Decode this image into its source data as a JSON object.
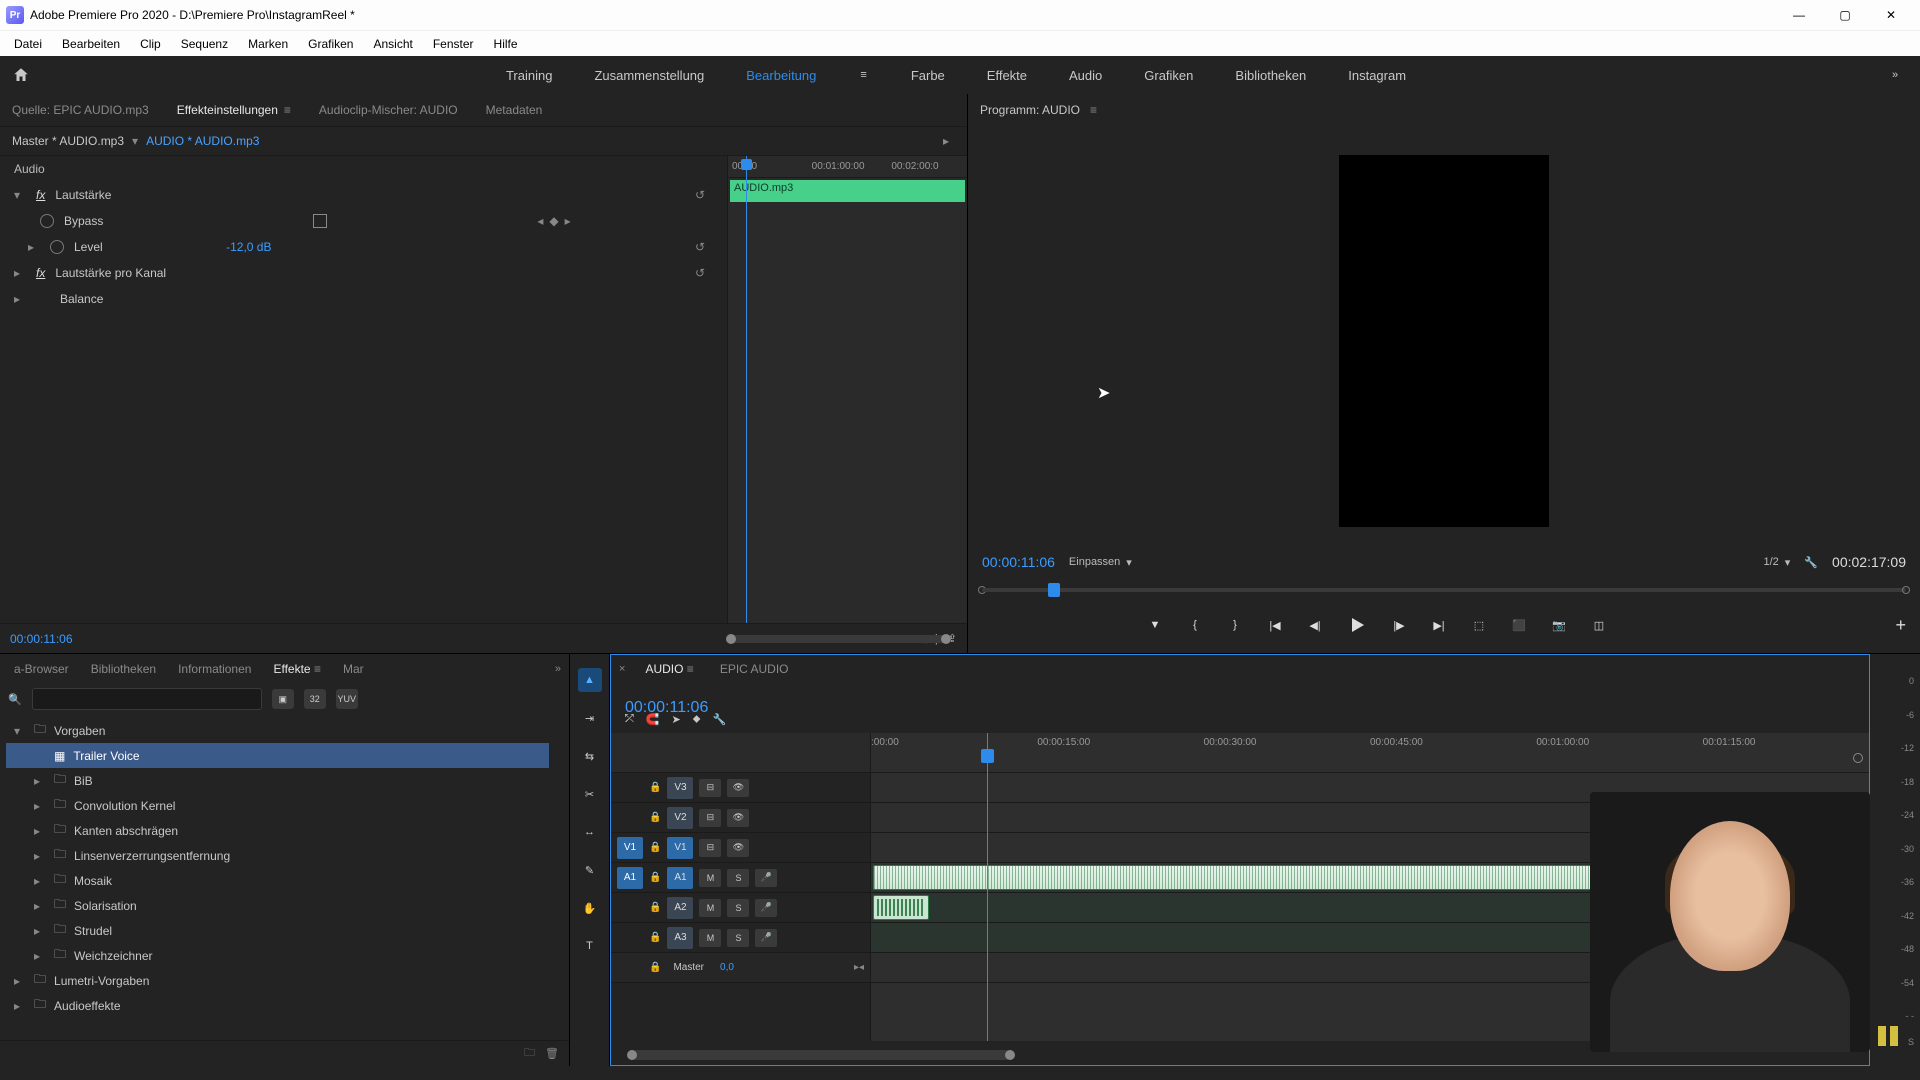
{
  "title": "Adobe Premiere Pro 2020 - D:\\Premiere Pro\\InstagramReel *",
  "menu": [
    "Datei",
    "Bearbeiten",
    "Clip",
    "Sequenz",
    "Marken",
    "Grafiken",
    "Ansicht",
    "Fenster",
    "Hilfe"
  ],
  "workspaces": {
    "items": [
      "Training",
      "Zusammenstellung",
      "Bearbeitung",
      "Farbe",
      "Effekte",
      "Audio",
      "Grafiken",
      "Bibliotheken",
      "Instagram"
    ],
    "active": "Bearbeitung"
  },
  "source_panel": {
    "tabs": [
      "Quelle: EPIC AUDIO.mp3",
      "Effekteinstellungen",
      "Audioclip-Mischer: AUDIO",
      "Metadaten"
    ],
    "active_tab": "Effekteinstellungen",
    "master_label": "Master * AUDIO.mp3",
    "clip_link": "AUDIO * AUDIO.mp3",
    "ruler": [
      "00:00",
      "00:01:00:00",
      "00:02:00:0"
    ],
    "clipbar": "AUDIO.mp3",
    "section": "Audio",
    "fx_volume": "Lautstärke",
    "bypass": "Bypass",
    "level": "Level",
    "level_val": "-12,0 dB",
    "fx_chan": "Lautstärke pro Kanal",
    "balance": "Balance",
    "timecode": "00:00:11:06"
  },
  "program_panel": {
    "title": "Programm: AUDIO",
    "timecode": "00:00:11:06",
    "fit": "Einpassen",
    "zoom": "1/2",
    "duration": "00:02:17:09"
  },
  "project_panel": {
    "tabs": [
      "a-Browser",
      "Bibliotheken",
      "Informationen",
      "Effekte",
      "Mar"
    ],
    "active_tab": "Effekte",
    "tree": [
      {
        "label": "Vorgaben",
        "lvl": 0,
        "open": true
      },
      {
        "label": "Trailer Voice",
        "lvl": 1,
        "sel": true,
        "preset": true
      },
      {
        "label": "BiB",
        "lvl": 1
      },
      {
        "label": "Convolution Kernel",
        "lvl": 1
      },
      {
        "label": "Kanten abschrägen",
        "lvl": 1
      },
      {
        "label": "Linsenverzerrungsentfernung",
        "lvl": 1
      },
      {
        "label": "Mosaik",
        "lvl": 1
      },
      {
        "label": "Solarisation",
        "lvl": 1
      },
      {
        "label": "Strudel",
        "lvl": 1
      },
      {
        "label": "Weichzeichner",
        "lvl": 1
      },
      {
        "label": "Lumetri-Vorgaben",
        "lvl": 0
      },
      {
        "label": "Audioeffekte",
        "lvl": 0
      }
    ]
  },
  "timeline": {
    "tabs": [
      "AUDIO",
      "EPIC AUDIO"
    ],
    "active_tab": "AUDIO",
    "timecode": "00:00:11:06",
    "ruler": [
      ":00:00",
      "00:00:15:00",
      "00:00:30:00",
      "00:00:45:00",
      "00:01:00:00",
      "00:01:15:00"
    ],
    "tracks_v": [
      "V3",
      "V2",
      "V1"
    ],
    "tracks_a": [
      "A1",
      "A2",
      "A3"
    ],
    "master": "Master",
    "master_val": "0,0"
  },
  "meter_labels": [
    "0",
    "-6",
    "-12",
    "-18",
    "-24",
    "-30",
    "-36",
    "-42",
    "-48",
    "-54",
    "- -",
    "S"
  ],
  "icons": {
    "reset": "↺",
    "play": "▶",
    "menu": "≡",
    "chev": "▾",
    "caret_r": "▸",
    "caret_d": "▾",
    "lock": "🔒",
    "eye": "👁",
    "folder": "🗀",
    "new_folder": "🗀",
    "trash": "🗑"
  }
}
